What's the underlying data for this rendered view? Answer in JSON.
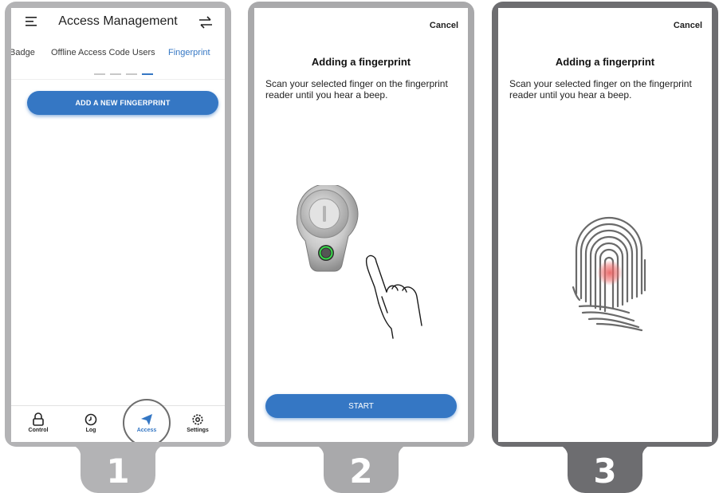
{
  "steps": [
    "1",
    "2",
    "3"
  ],
  "screen1": {
    "title": "Access Management",
    "tabs": [
      {
        "label": "Badge",
        "active": false
      },
      {
        "label": "Offline Access Code Users",
        "active": false
      },
      {
        "label": "Fingerprint",
        "active": true
      }
    ],
    "add_button": "ADD A NEW FINGERPRINT",
    "nav": [
      {
        "label": "Control",
        "icon": "lock-icon",
        "active": false
      },
      {
        "label": "Log",
        "icon": "clock-icon",
        "active": false
      },
      {
        "label": "Access",
        "icon": "send-icon",
        "active": true
      },
      {
        "label": "Settings",
        "icon": "gear-icon",
        "active": false
      }
    ]
  },
  "screen2": {
    "cancel": "Cancel",
    "heading": "Adding a fingerprint",
    "instruction": "Scan your selected finger on the fingerprint reader until you hear a beep.",
    "start_button": "START"
  },
  "screen3": {
    "cancel": "Cancel",
    "heading": "Adding a fingerprint",
    "instruction": "Scan your selected finger on the fingerprint reader until you hear a beep."
  },
  "colors": {
    "accent": "#3577c4",
    "panel1": "#b3b3b5",
    "panel2": "#a9a9ab",
    "panel3": "#6d6d70",
    "scan_dot": "#e85a5a"
  }
}
